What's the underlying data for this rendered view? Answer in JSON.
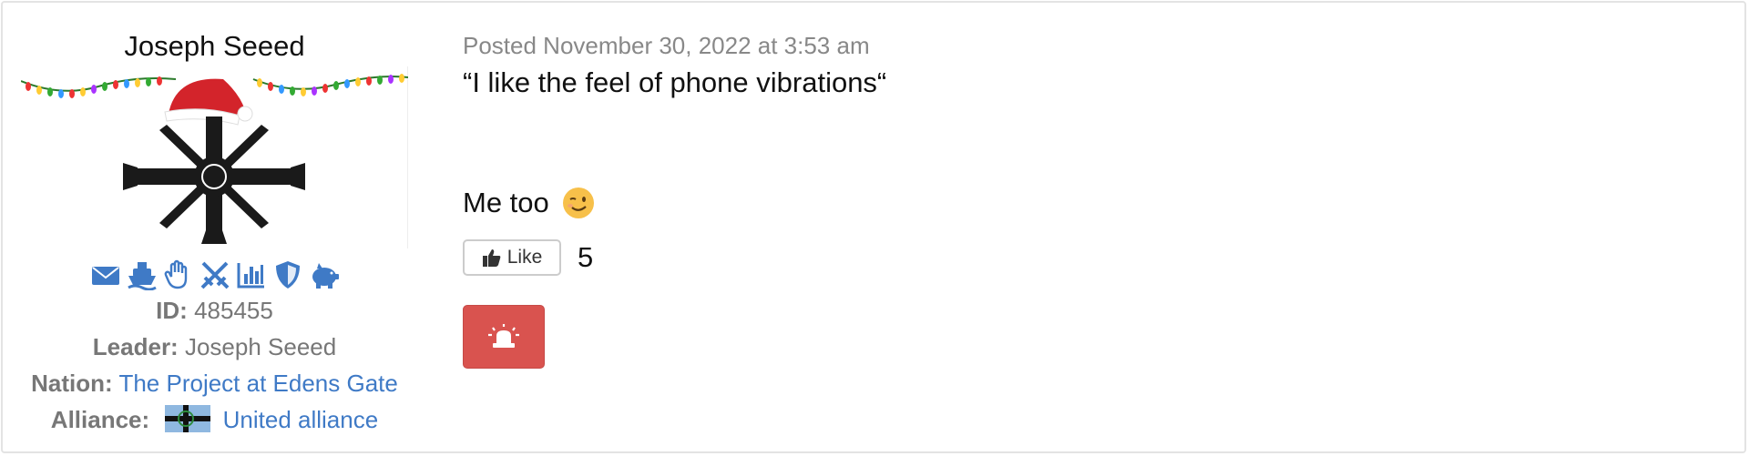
{
  "user": {
    "name": "Joseph Seeed",
    "icons": [
      "envelope-icon",
      "ship-icon",
      "hand-icon",
      "crossed-swords-icon",
      "bar-chart-icon",
      "shield-icon",
      "piggy-bank-icon"
    ],
    "id_label": "ID:",
    "id_value": "485455",
    "leader_label": "Leader:",
    "leader_value": "Joseph Seeed",
    "nation_label": "Nation:",
    "nation_value": "The Project at Edens Gate",
    "alliance_label": "Alliance:",
    "alliance_value": "United alliance"
  },
  "post": {
    "posted": "Posted November 30, 2022 at 3:53 am",
    "quote": "“I like the feel of phone vibrations“",
    "reply": "Me too",
    "reply_emoji": "winking-face-emoji",
    "like_label": "Like",
    "like_count": "5",
    "report_icon": "siren-icon"
  },
  "colors": {
    "link": "#3f7ac6",
    "icon": "#3f7ac6",
    "report": "#d9534f"
  }
}
